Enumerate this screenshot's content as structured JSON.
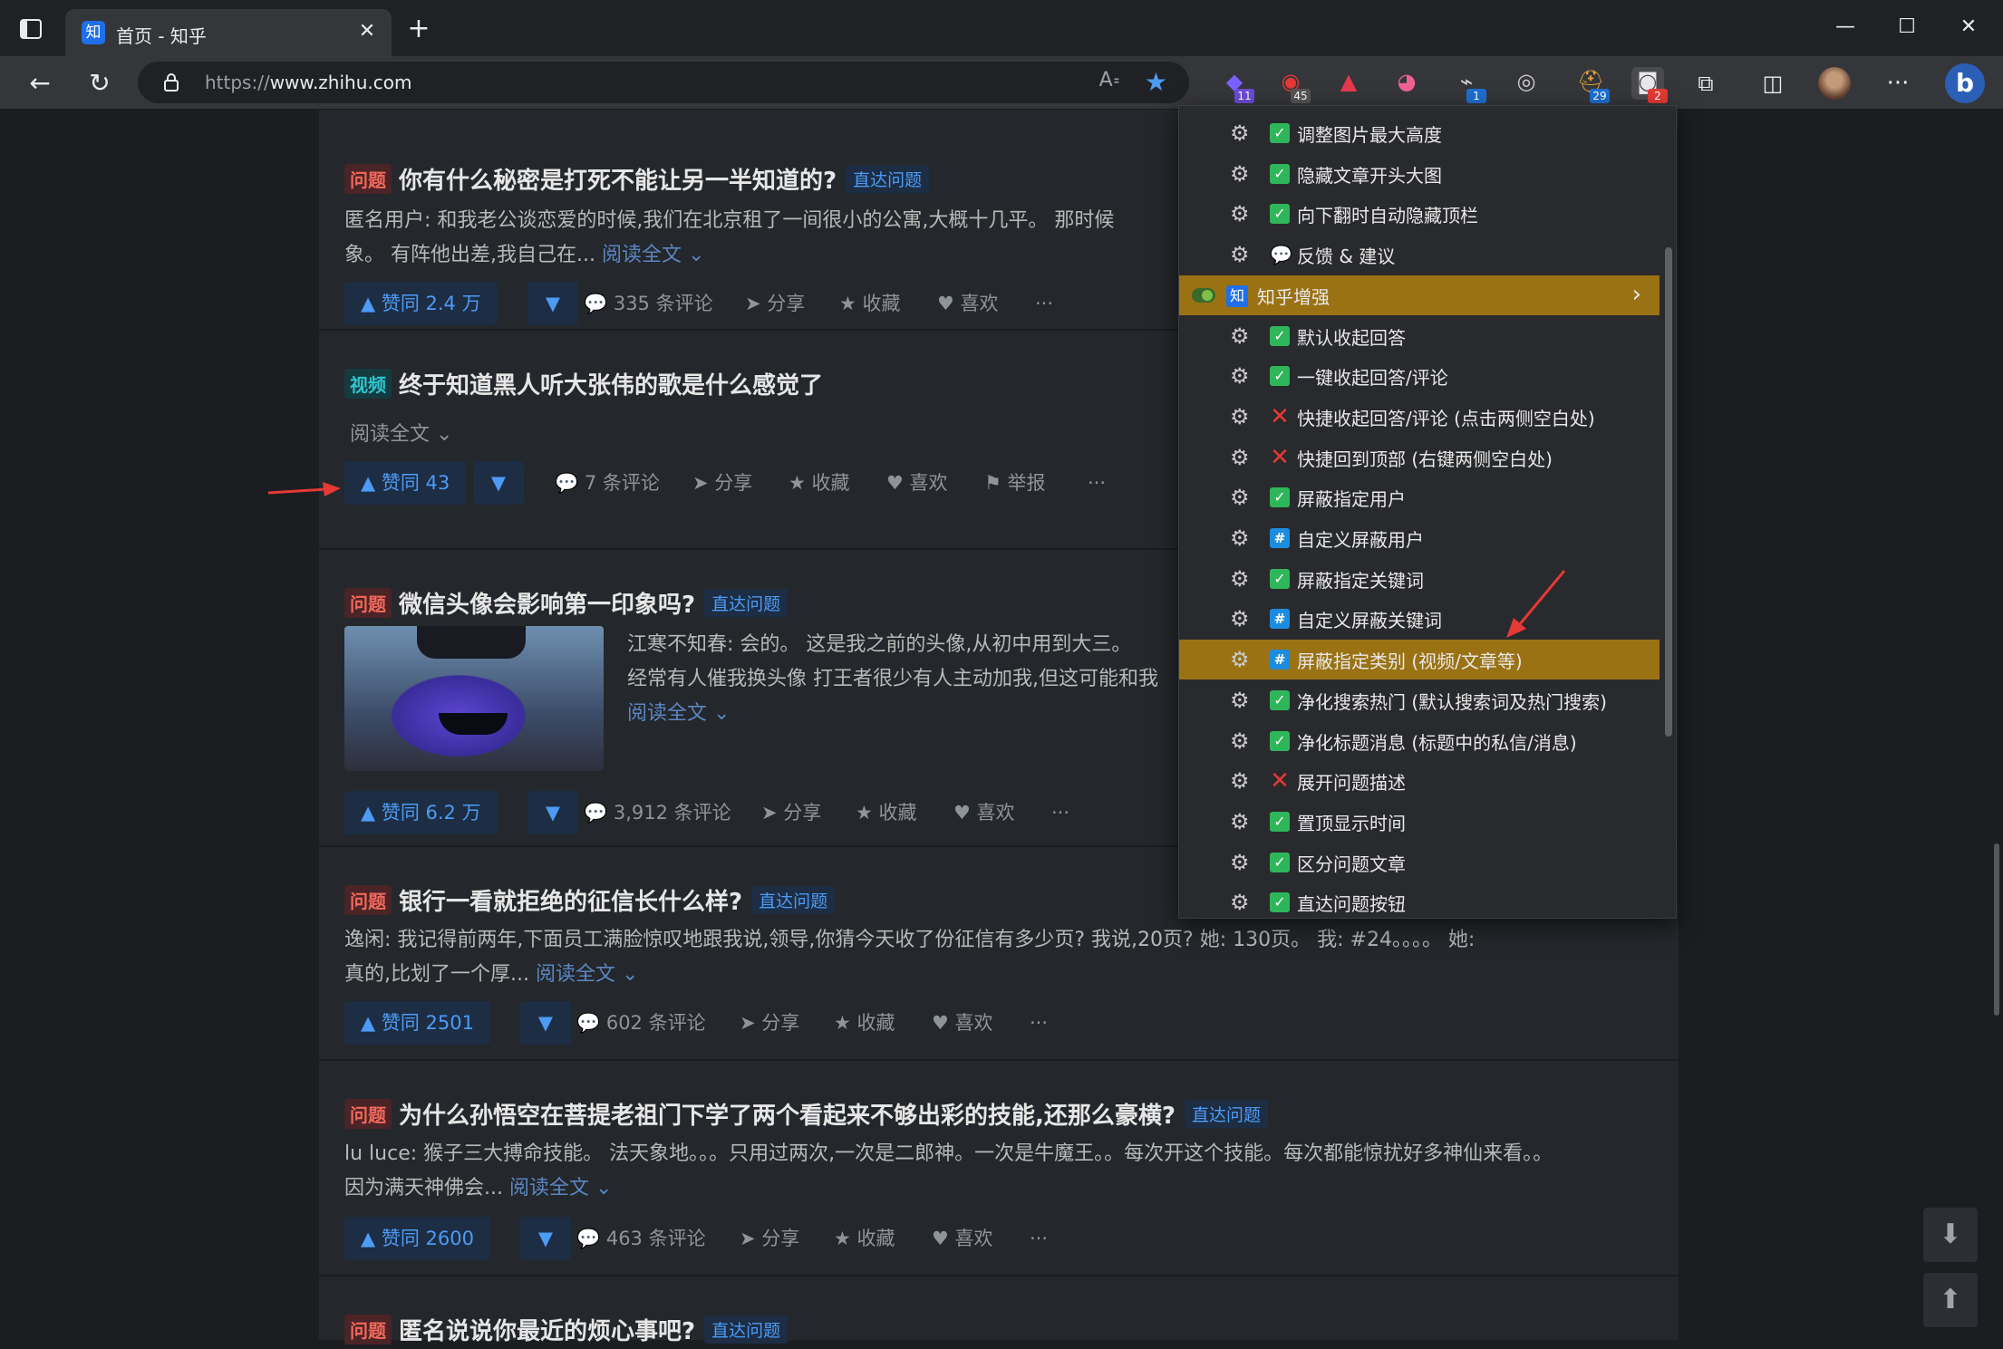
{
  "browser": {
    "tab_title": "首页 - 知乎",
    "tab_favicon": "知",
    "url_prefix": "https://",
    "url_host": "www.zhihu.com",
    "extensions": [
      {
        "name": "ext-purple-icon",
        "badge": "11",
        "badge_color": "#6b4cd6",
        "color": "#7b61ff"
      },
      {
        "name": "ext-adblock-icon",
        "badge": "45",
        "badge_color": "#555",
        "color": "#e53935"
      },
      {
        "name": "ext-red-a-icon",
        "badge": "",
        "badge_color": "",
        "color": "#e63950"
      },
      {
        "name": "ext-cat-icon",
        "badge": "",
        "badge_color": "",
        "color": "#f06292"
      },
      {
        "name": "ext-dev-icon",
        "badge": "1",
        "badge_color": "#1d6fd1",
        "color": "#cfcfcf"
      },
      {
        "name": "ext-glasses-icon",
        "badge": "",
        "badge_color": "",
        "color": "#cfcfcf"
      },
      {
        "name": "ext-tampermonkey-icon",
        "badge": "29",
        "badge_color": "#1d6fd1",
        "color": "#e0a040"
      },
      {
        "name": "ext-active-icon",
        "badge": "2",
        "badge_color": "#e53935",
        "color": "#e8e8e8"
      }
    ]
  },
  "feed": [
    {
      "tag": "问题",
      "title": "你有什么秘密是打死不能让另一半知道的?",
      "direct": "直达问题",
      "excerpt_line1": "匿名用户: 和我老公谈恋爱的时候,我们在北京租了一间很小的公寓,大概十几平。 那时候",
      "excerpt_line2": "象。 有阵他出差,我自己在...",
      "readmore": "阅读全文 ⌄",
      "vote": "▲ 赞同 2.4 万",
      "comments": "335 条评论",
      "share": "分享",
      "collect": "收藏",
      "like": "喜欢",
      "more": "···"
    },
    {
      "tag": "视频",
      "title": "终于知道黑人听大张伟的歌是什么感觉了",
      "readmore": "阅读全文 ⌄",
      "vote": "▲ 赞同 43",
      "comments": "7 条评论",
      "share": "分享",
      "collect": "收藏",
      "like": "喜欢",
      "report": "举报",
      "more": "···"
    },
    {
      "tag": "问题",
      "title": "微信头像会影响第一印象吗?",
      "direct": "直达问题",
      "excerpt_line1": "江寒不知春: 会的。 这是我之前的头像,从初中用到大三。",
      "excerpt_line2": "经常有人催我换头像 打王者很少有人主动加我,但这可能和我",
      "readmore": "阅读全文 ⌄",
      "vote": "▲ 赞同 6.2 万",
      "comments": "3,912 条评论",
      "share": "分享",
      "collect": "收藏",
      "like": "喜欢",
      "more": "···"
    },
    {
      "tag": "问题",
      "title": "银行一看就拒绝的征信长什么样?",
      "direct": "直达问题",
      "excerpt_line1": "逸闲: 我记得前两年,下面员工满脸惊叹地跟我说,领导,你猜今天收了份征信有多少页? 我说,20页? 她: 130页。 我: #24。。。。 她:",
      "excerpt_line2": "真的,比划了一个厚...",
      "readmore": "阅读全文 ⌄",
      "vote": "▲ 赞同 2501",
      "comments": "602 条评论",
      "share": "分享",
      "collect": "收藏",
      "like": "喜欢",
      "more": "···"
    },
    {
      "tag": "问题",
      "title": "为什么孙悟空在菩提老祖门下学了两个看起来不够出彩的技能,还那么豪横?",
      "direct": "直达问题",
      "excerpt_line1": "lu luce: 猴子三大搏命技能。 法天象地。。。只用过两次,一次是二郎神。一次是牛魔王。。每次开这个技能。每次都能惊扰好多神仙来看。。",
      "excerpt_line2": "因为满天神佛会...",
      "readmore": "阅读全文 ⌄",
      "vote": "▲ 赞同 2600",
      "comments": "463 条评论",
      "share": "分享",
      "collect": "收藏",
      "like": "喜欢",
      "more": "···"
    },
    {
      "tag": "问题",
      "title": "匿名说说你最近的烦心事吧?",
      "direct": "直达问题"
    }
  ],
  "menu": {
    "items": [
      {
        "status": "check",
        "label": "调整图片最大高度"
      },
      {
        "status": "check",
        "label": "隐藏文章开头大图"
      },
      {
        "status": "check",
        "label": "向下翻时自动隐藏顶栏"
      },
      {
        "status": "bubble",
        "label": "反馈 & 建议"
      },
      {
        "status": "submenu",
        "label": "知乎增强",
        "logo": "知"
      },
      {
        "status": "check",
        "label": "默认收起回答"
      },
      {
        "status": "check",
        "label": "一键收起回答/评论"
      },
      {
        "status": "cross",
        "label": "快捷收起回答/评论 (点击两侧空白处)"
      },
      {
        "status": "cross",
        "label": "快捷回到顶部 (右键两侧空白处)"
      },
      {
        "status": "check",
        "label": "屏蔽指定用户"
      },
      {
        "status": "hash",
        "label": "自定义屏蔽用户"
      },
      {
        "status": "check",
        "label": "屏蔽指定关键词"
      },
      {
        "status": "hash",
        "label": "自定义屏蔽关键词"
      },
      {
        "status": "hash",
        "label": "屏蔽指定类别 (视频/文章等)",
        "highlight": true
      },
      {
        "status": "check",
        "label": "净化搜索热门 (默认搜索词及热门搜索)"
      },
      {
        "status": "check",
        "label": "净化标题消息 (标题中的私信/消息)"
      },
      {
        "status": "cross",
        "label": "展开问题描述"
      },
      {
        "status": "check",
        "label": "置顶显示时间"
      },
      {
        "status": "check",
        "label": "区分问题文章"
      },
      {
        "status": "check",
        "label": "直达问题按钮"
      }
    ]
  },
  "colors": {
    "accent_blue": "#4c9bf5",
    "menu_highlight": "#9a7214",
    "check_green": "#2fb65a",
    "cross_red": "#e53935",
    "hash_blue": "#1d8ce0"
  }
}
